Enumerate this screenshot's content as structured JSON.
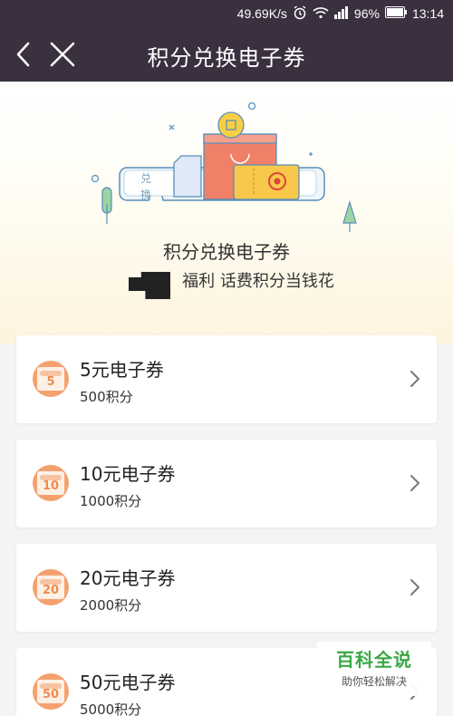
{
  "status_bar": {
    "speed": "49.69K/s",
    "battery": "96%",
    "time": "13:14",
    "icons": [
      "alarm-icon",
      "wifi-icon",
      "signal-icon",
      "battery-icon"
    ]
  },
  "header": {
    "title": "积分兑换电子券",
    "back_icon": "back-arrow-icon",
    "close_icon": "close-icon"
  },
  "hero": {
    "title": "积分兑换电子券",
    "subtitle": "福利 话费积分当钱花",
    "ticket_text": [
      "兑",
      "换"
    ]
  },
  "vouchers": [
    {
      "badge": "5",
      "name": "5元电子券",
      "points": "500积分"
    },
    {
      "badge": "10",
      "name": "10元电子券",
      "points": "1000积分"
    },
    {
      "badge": "20",
      "name": "20元电子券",
      "points": "2000积分"
    },
    {
      "badge": "50",
      "name": "50元电子券",
      "points": "5000积分"
    }
  ],
  "watermark": {
    "main": "百科全说",
    "sub": "助你轻松解决"
  },
  "colors": {
    "header_bg": "#3a3040",
    "badge_orange": "#f5a16f",
    "watermark_green": "#3aa845"
  }
}
